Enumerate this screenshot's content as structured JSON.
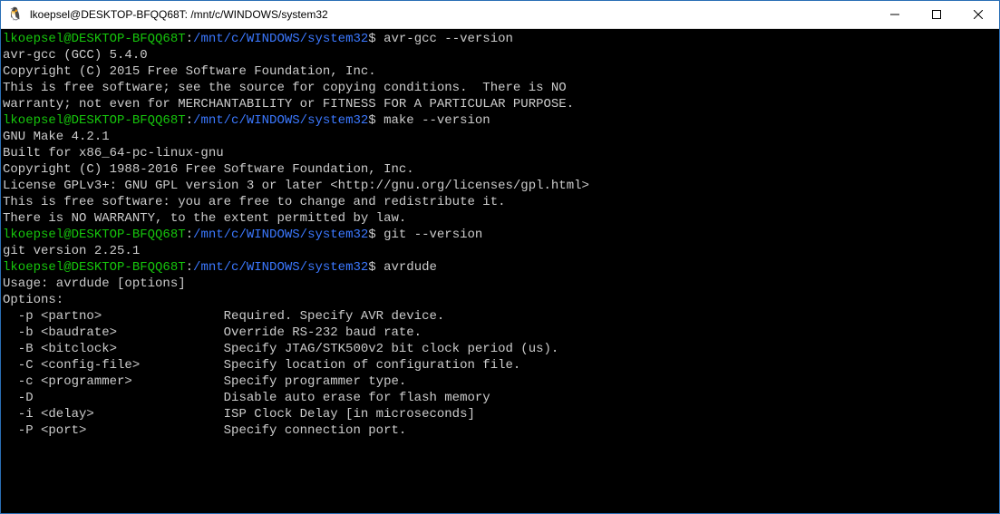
{
  "window": {
    "title": "lkoepsel@DESKTOP-BFQQ68T: /mnt/c/WINDOWS/system32",
    "icon_glyph": "🐧"
  },
  "prompt": {
    "user": "lkoepsel@DESKTOP-BFQQ68T",
    "colon": ":",
    "path": "/mnt/c/WINDOWS/system32",
    "symbol": "$"
  },
  "sessions": [
    {
      "command": "avr-gcc --version",
      "output": [
        "avr-gcc (GCC) 5.4.0",
        "Copyright (C) 2015 Free Software Foundation, Inc.",
        "This is free software; see the source for copying conditions.  There is NO",
        "warranty; not even for MERCHANTABILITY or FITNESS FOR A PARTICULAR PURPOSE.",
        ""
      ]
    },
    {
      "command": "make --version",
      "output": [
        "GNU Make 4.2.1",
        "Built for x86_64-pc-linux-gnu",
        "Copyright (C) 1988-2016 Free Software Foundation, Inc.",
        "License GPLv3+: GNU GPL version 3 or later <http://gnu.org/licenses/gpl.html>",
        "This is free software: you are free to change and redistribute it.",
        "There is NO WARRANTY, to the extent permitted by law."
      ]
    },
    {
      "command": "git --version",
      "output": [
        "git version 2.25.1"
      ]
    },
    {
      "command": "avrdude",
      "output": [
        "Usage: avrdude [options]",
        "Options:",
        "  -p <partno>                Required. Specify AVR device.",
        "  -b <baudrate>              Override RS-232 baud rate.",
        "  -B <bitclock>              Specify JTAG/STK500v2 bit clock period (us).",
        "  -C <config-file>           Specify location of configuration file.",
        "  -c <programmer>            Specify programmer type.",
        "  -D                         Disable auto erase for flash memory",
        "  -i <delay>                 ISP Clock Delay [in microseconds]",
        "  -P <port>                  Specify connection port."
      ]
    }
  ]
}
